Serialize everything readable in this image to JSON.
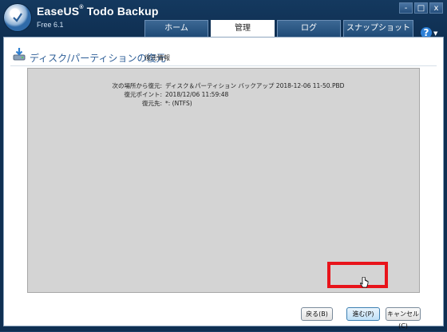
{
  "app": {
    "title_main": "EaseUS",
    "title_reg": "®",
    "title_rest": " Todo Backup",
    "version": "Free 6.1"
  },
  "window_controls": {
    "minimize": "-",
    "maximize": "□",
    "close": "x"
  },
  "tabs": [
    {
      "label": "ホーム",
      "active": false
    },
    {
      "label": "管理",
      "active": true
    },
    {
      "label": "ログ",
      "active": false
    },
    {
      "label": "スナップショット",
      "active": false
    }
  ],
  "help": {
    "label": "?"
  },
  "page": {
    "title": "ディスク/パーティションの復元",
    "subtitle": "復元情報"
  },
  "info": {
    "rows": [
      {
        "label": "次の場所から復元:",
        "value": "ディスク＆パーティション バックアップ 2018-12-06 11-50.PBD"
      },
      {
        "label": "復元ポイント:",
        "value": "2018/12/06 11:59:48"
      },
      {
        "label": "復元先:",
        "value": "*: (NTFS)"
      }
    ]
  },
  "buttons": {
    "back": "戻る(B)",
    "next": "進む(P)",
    "cancel": "キャンセル(C)"
  },
  "colors": {
    "highlight": "#e8141b",
    "title_blue": "#2d5e97"
  }
}
